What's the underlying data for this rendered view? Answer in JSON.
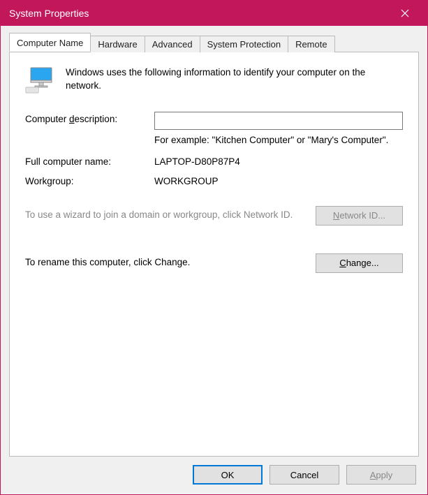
{
  "window": {
    "title": "System Properties"
  },
  "tabs": {
    "computer_name": "Computer Name",
    "hardware": "Hardware",
    "advanced": "Advanced",
    "system_protection": "System Protection",
    "remote": "Remote"
  },
  "intro": "Windows uses the following information to identify your computer on the network.",
  "fields": {
    "description_label_pre": "Computer ",
    "description_label_key": "d",
    "description_label_post": "escription:",
    "description_value": "",
    "description_hint": "For example: \"Kitchen Computer\" or \"Mary's Computer\".",
    "fullname_label": "Full computer name:",
    "fullname_value": "LAPTOP-D80P87P4",
    "workgroup_label": "Workgroup:",
    "workgroup_value": "WORKGROUP"
  },
  "actions": {
    "networkid_hint": "To use a wizard to join a domain or workgroup, click Network ID.",
    "networkid_btn_key": "N",
    "networkid_btn_post": "etwork ID...",
    "change_hint": "To rename this computer, click Change.",
    "change_btn_key": "C",
    "change_btn_post": "hange..."
  },
  "footer": {
    "ok": "OK",
    "cancel": "Cancel",
    "apply_key": "A",
    "apply_post": "pply"
  }
}
